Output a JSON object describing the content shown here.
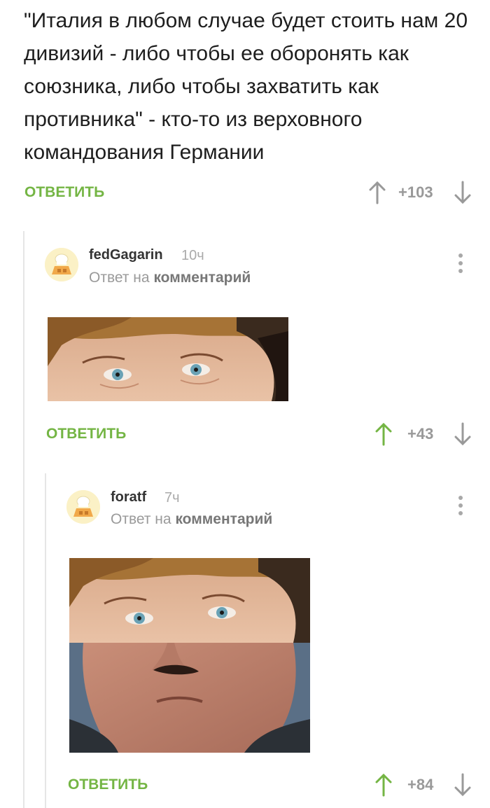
{
  "root_comment": {
    "text": "\"Италия в любом случае будет стоить нам 20 дивизий - либо чтобы ее оборонять как союзника, либо чтобы захватить как противника\" - кто-то из верховного командования Германии",
    "reply_label": "ОТВЕТИТЬ",
    "score": "+103"
  },
  "reply1": {
    "username": "fedGagarin",
    "time": "10ч",
    "reply_to_prefix": "Ответ на",
    "reply_to_link": "комментарий",
    "reply_label": "ОТВЕТИТЬ",
    "score": "+43",
    "image": "eyes-crop-photo"
  },
  "reply2": {
    "username": "foratf",
    "time": "7ч",
    "reply_to_prefix": "Ответ на",
    "reply_to_link": "комментарий",
    "reply_label": "ОТВЕТИТЬ",
    "score": "+84",
    "image": "eyes-and-mustache-collage-photo"
  },
  "colors": {
    "accent_green": "#74b544",
    "score_gray": "#999999",
    "thread_line": "#e6e6e6"
  }
}
